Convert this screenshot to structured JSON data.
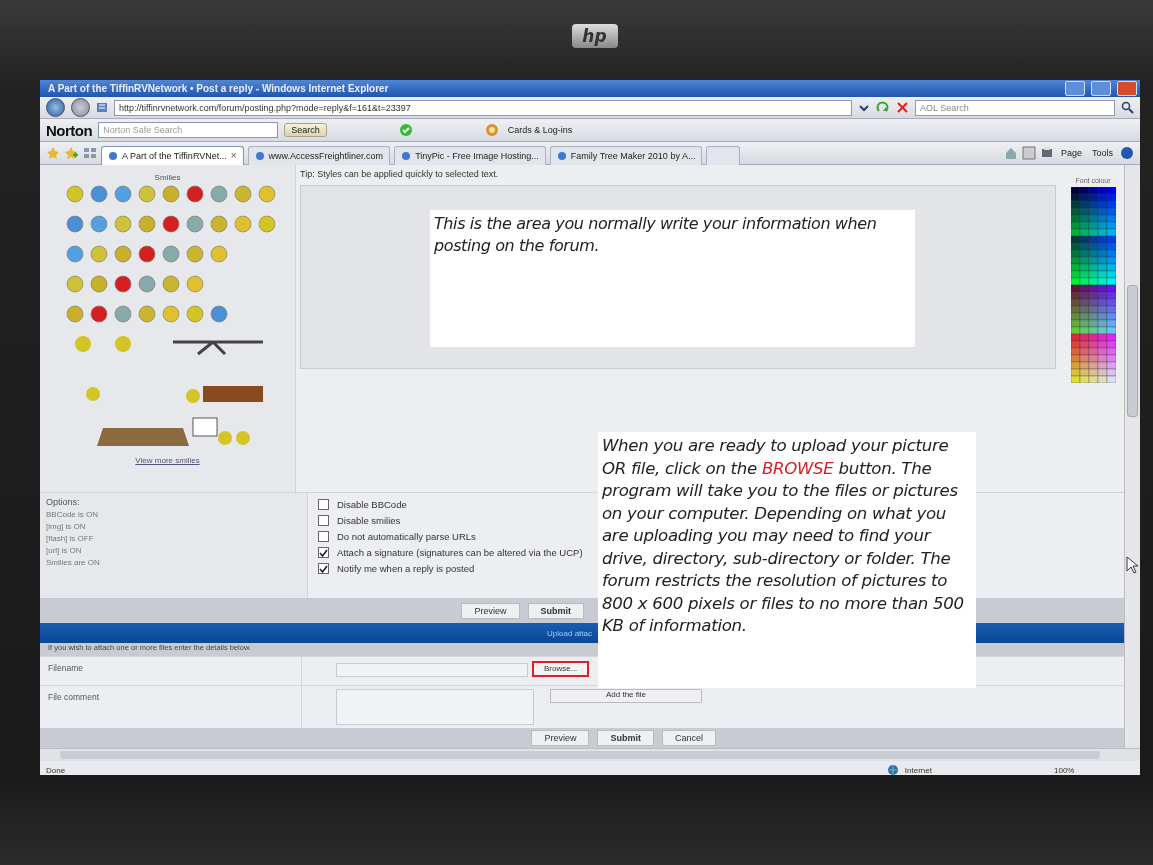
{
  "bezel": {
    "logo": "hp"
  },
  "window": {
    "title": "A Part of the TiffinRVNetwork • Post a reply - Windows Internet Explorer",
    "url": "http://tiffinrvnetwork.com/forum/posting.php?mode=reply&f=161&t=23397",
    "search_placeholder": "AOL Search"
  },
  "norton": {
    "brand": "Norton",
    "search_placeholder": "Norton Safe Search",
    "search_button": "Search",
    "cards": "Cards & Log-ins"
  },
  "tab_close": "×",
  "tabs": [
    {
      "label": "A Part of the TiffinRVNet...",
      "selected": true
    },
    {
      "label": "www.AccessFreightliner.com",
      "selected": false
    },
    {
      "label": "TinyPic - Free Image Hosting...",
      "selected": false
    },
    {
      "label": "Family Tree Maker 2010 by A...",
      "selected": false
    }
  ],
  "command_bar": [
    "Page",
    "Tools"
  ],
  "smilies": {
    "title": "Smilies",
    "more_link": "View more smilies"
  },
  "editor": {
    "tip": "Tip: Styles can be applied quickly to selected text.",
    "palette_title": "Font colour"
  },
  "options": {
    "title": "Options:",
    "statuses": [
      "BBCode is ON",
      "[img] is ON",
      "[flash] is OFF",
      "[url] is ON",
      "Smilies are ON"
    ]
  },
  "checkboxes": [
    {
      "label": "Disable BBCode",
      "checked": false
    },
    {
      "label": "Disable smilies",
      "checked": false
    },
    {
      "label": "Do not automatically parse URLs",
      "checked": false
    },
    {
      "label": "Attach a signature (signatures can be altered via the UCP)",
      "checked": true
    },
    {
      "label": "Notify me when a reply is posted",
      "checked": true
    }
  ],
  "post_buttons": [
    {
      "label": "Preview",
      "primary": false
    },
    {
      "label": "Submit",
      "primary": true
    }
  ],
  "upload": {
    "header": "Upload attac",
    "instruction": "If you wish to attach one or more files enter the details below.",
    "filename_label": "Filename",
    "browse_button": {
      "label": "Browse...",
      "highlighted": true
    },
    "comment_label": "File comment",
    "add_button": "Add the file"
  },
  "bottom_buttons": [
    {
      "label": "Preview",
      "primary": false
    },
    {
      "label": "Submit",
      "primary": true
    },
    {
      "label": "Cancel",
      "primary": false
    }
  ],
  "status_bar": {
    "status": "Done",
    "zone": "Internet",
    "zoom": "100%"
  },
  "notes": [
    {
      "segments": [
        {
          "text": "This is the area you normally write your information when posting on the forum.",
          "highlight": false
        }
      ]
    },
    {
      "segments": [
        {
          "text": "When you are ready to upload your picture OR file, click on the ",
          "highlight": false
        },
        {
          "text": "BROWSE",
          "highlight": true
        },
        {
          "text": " button. The program will take you to the files or pictures on your computer. Depending on what you are uploading you may need to find your drive, directory, sub-directory or folder. The forum restricts the resolution of pictures to 800 x 600 pixels or files to no more than 500 KB of information.",
          "highlight": false
        }
      ]
    }
  ]
}
